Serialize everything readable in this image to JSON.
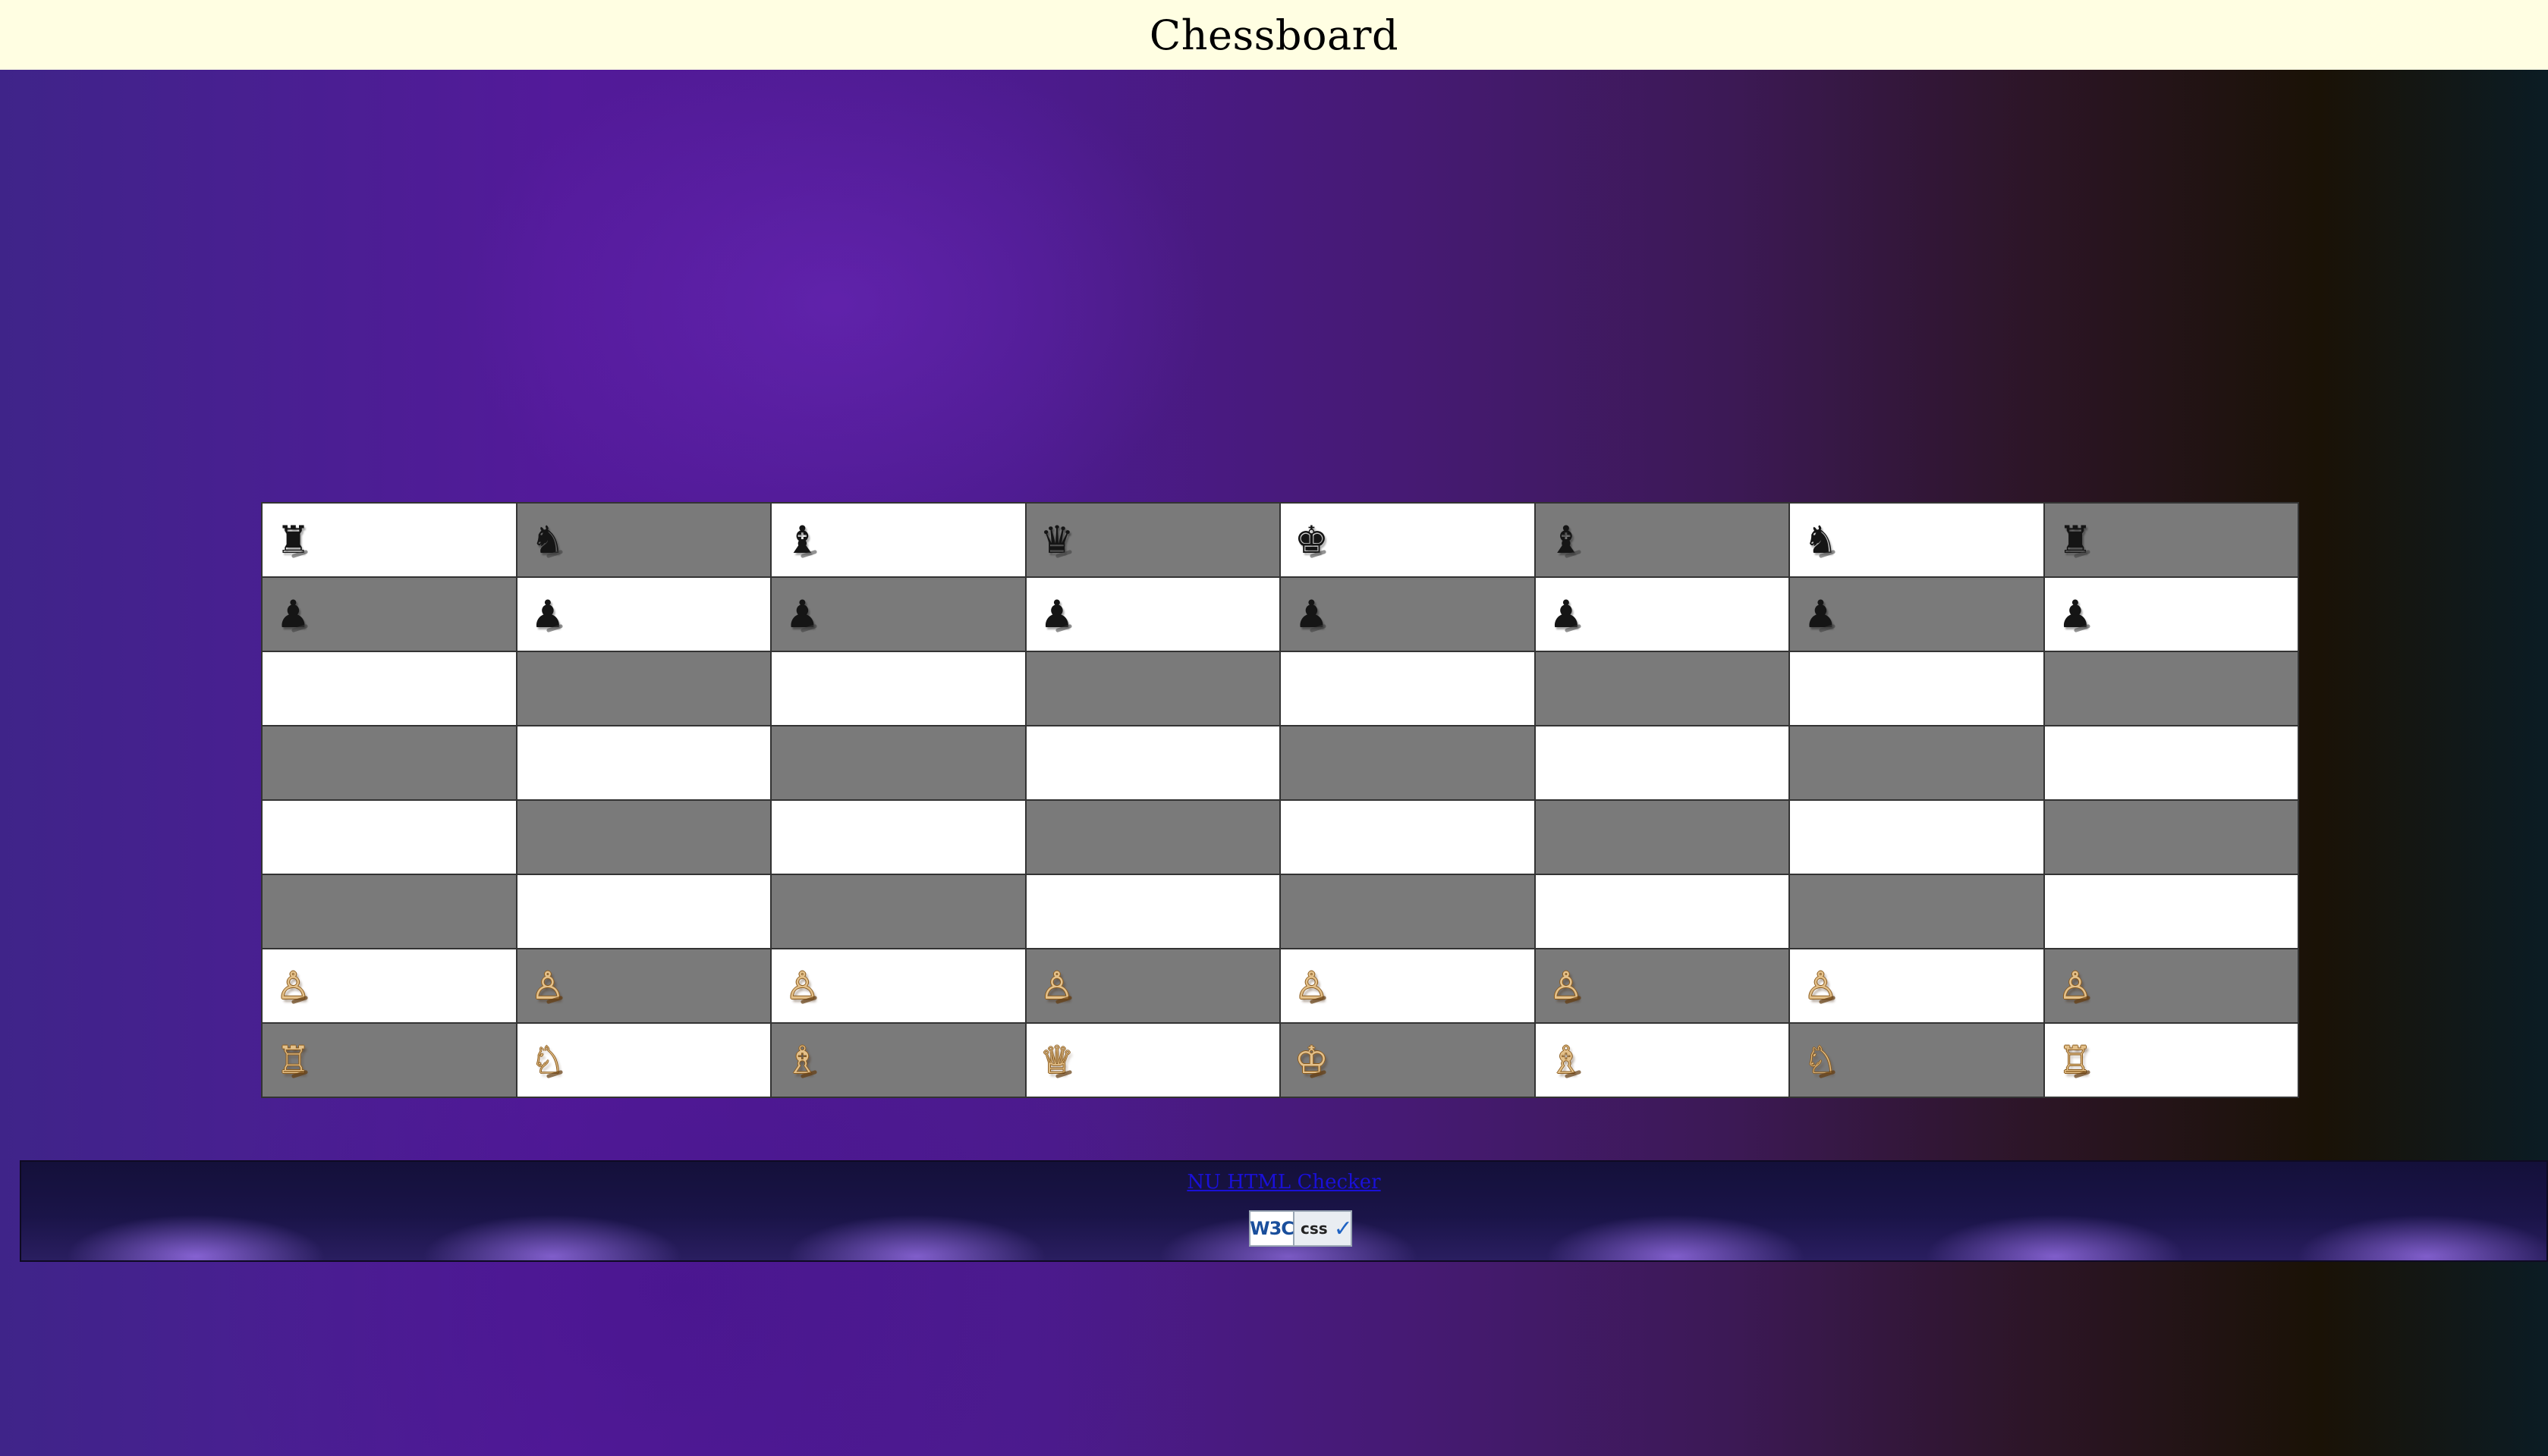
{
  "header": {
    "title": "Chessboard"
  },
  "board": {
    "rows": [
      [
        "♜",
        "♞",
        "♝",
        "♛",
        "♚",
        "♝",
        "♞",
        "♜"
      ],
      [
        "♟",
        "♟",
        "♟",
        "♟",
        "♟",
        "♟",
        "♟",
        "♟"
      ],
      [
        "",
        "",
        "",
        "",
        "",
        "",
        "",
        ""
      ],
      [
        "",
        "",
        "",
        "",
        "",
        "",
        "",
        ""
      ],
      [
        "",
        "",
        "",
        "",
        "",
        "",
        "",
        ""
      ],
      [
        "",
        "",
        "",
        "",
        "",
        "",
        "",
        ""
      ],
      [
        "♙",
        "♙",
        "♙",
        "♙",
        "♙",
        "♙",
        "♙",
        "♙"
      ],
      [
        "♖",
        "♘",
        "♗",
        "♕",
        "♔",
        "♗",
        "♘",
        "♖"
      ]
    ],
    "colors": {
      "light": "#ffffff",
      "dark": "#7a7a7a",
      "black_piece": "#151515",
      "white_piece": "#e3c08a"
    }
  },
  "footer": {
    "validator_link": "NU HTML Checker",
    "badge": {
      "w3c": "W3C",
      "css": "css",
      "check": "✓"
    }
  }
}
